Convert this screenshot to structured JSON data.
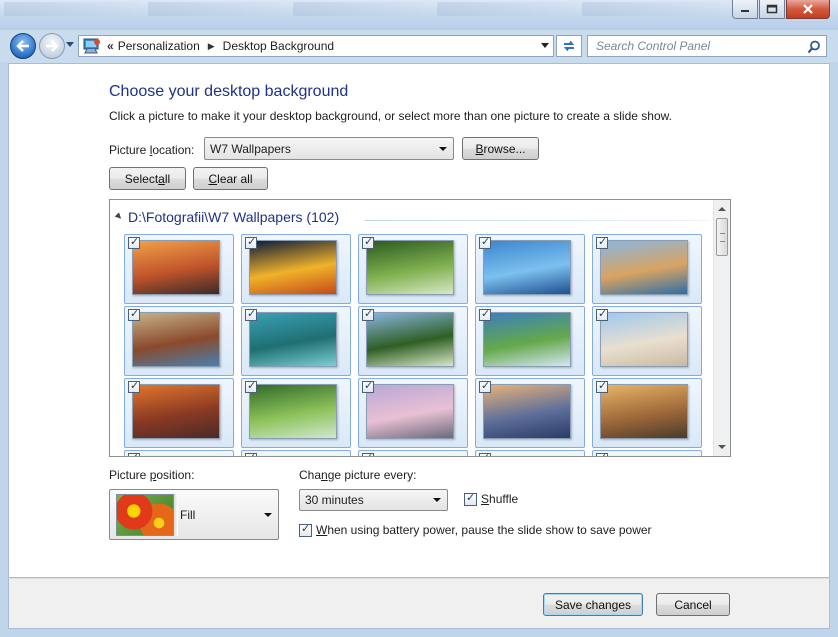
{
  "address": {
    "breadcrumbs": [
      "Personalization",
      "Desktop Background"
    ],
    "chevron": "«",
    "search_placeholder": "Search Control Panel"
  },
  "page": {
    "heading": "Choose your desktop background",
    "subtext": "Click a picture to make it your desktop background, or select more than one picture to create a slide show."
  },
  "picture_location": {
    "label_prefix": "Picture ",
    "label_accel": "l",
    "label_suffix": "ocation:",
    "value": "W7 Wallpapers",
    "browse_prefix": "",
    "browse_accel": "B",
    "browse_suffix": "rowse..."
  },
  "selection_buttons": {
    "select_all_prefix": "Select ",
    "select_all_accel": "a",
    "select_all_suffix": "ll",
    "clear_all_prefix": "",
    "clear_all_accel": "C",
    "clear_all_suffix": "lear all"
  },
  "gallery": {
    "group_title": "D:\\Fotografii\\W7 Wallpapers (102)",
    "thumbnails": [
      {
        "name": "baobab-trees",
        "checked": true,
        "colors": [
          "#f2a04a",
          "#c0542a",
          "#3a2a2a"
        ]
      },
      {
        "name": "sydney-fireworks",
        "checked": true,
        "colors": [
          "#0d1a3a",
          "#f0b22a",
          "#c24b1b"
        ]
      },
      {
        "name": "forest-waterfall",
        "checked": true,
        "colors": [
          "#2c5a22",
          "#7fb04e",
          "#d9e8c8"
        ]
      },
      {
        "name": "sydney-harbour",
        "checked": true,
        "colors": [
          "#3b86d0",
          "#7cc0ee",
          "#1f4f8f"
        ]
      },
      {
        "name": "twelve-apostles",
        "checked": true,
        "colors": [
          "#89b6e0",
          "#d9a362",
          "#2d6fa6"
        ]
      },
      {
        "name": "river-gorge",
        "checked": true,
        "colors": [
          "#c6b28a",
          "#8a4a2c",
          "#4b7fb0"
        ]
      },
      {
        "name": "tropical-islands",
        "checked": true,
        "colors": [
          "#3aa0b5",
          "#1f6f72",
          "#7dcfd6"
        ]
      },
      {
        "name": "lily-pads",
        "checked": true,
        "colors": [
          "#8ab4e0",
          "#2f5f24",
          "#d8e6c8"
        ]
      },
      {
        "name": "rainbow-coast",
        "checked": true,
        "colors": [
          "#3a7fbf",
          "#65a84a",
          "#d4e6f5"
        ]
      },
      {
        "name": "sand-dunes",
        "checked": true,
        "colors": [
          "#9ec8ee",
          "#e9dfcf",
          "#c9b9a4"
        ]
      },
      {
        "name": "canyon-sunset",
        "checked": true,
        "colors": [
          "#e2762e",
          "#8a3a22",
          "#4a2a2a"
        ]
      },
      {
        "name": "rainforest-stream",
        "checked": true,
        "colors": [
          "#2f6a2a",
          "#8ec25a",
          "#cfe8d0"
        ]
      },
      {
        "name": "stonehenge",
        "checked": true,
        "colors": [
          "#b7a8d6",
          "#e9c0d4",
          "#6a6a7a"
        ]
      },
      {
        "name": "tower-bridge",
        "checked": true,
        "colors": [
          "#e8b27a",
          "#5f6f9a",
          "#2a3a6a"
        ]
      },
      {
        "name": "misty-lake",
        "checked": true,
        "colors": [
          "#e8b468",
          "#a06a3a",
          "#4a3a2a"
        ]
      },
      {
        "name": "partial-1",
        "checked": true,
        "colors": [
          "#c07040",
          "#7a4030",
          "#3a2a2a"
        ]
      },
      {
        "name": "partial-2",
        "checked": true,
        "colors": [
          "#4a8ac0",
          "#2f6aa0",
          "#1f3f6a"
        ]
      },
      {
        "name": "partial-3",
        "checked": true,
        "colors": [
          "#8ab4d8",
          "#5f8fba",
          "#3f6a90"
        ]
      },
      {
        "name": "partial-4",
        "checked": true,
        "colors": [
          "#6a9fd8",
          "#3f7ab5",
          "#2a4f80"
        ]
      },
      {
        "name": "partial-5",
        "checked": true,
        "colors": [
          "#7fb0e0",
          "#4f86c0",
          "#2f5a8a"
        ]
      }
    ]
  },
  "picture_position": {
    "label_prefix": "Picture ",
    "label_accel": "p",
    "label_suffix": "osition:",
    "value": "Fill"
  },
  "slideshow": {
    "change_prefix": "Cha",
    "change_accel": "n",
    "change_suffix": "ge picture every:",
    "interval": "30 minutes",
    "shuffle_accel": "S",
    "shuffle_suffix": "huffle",
    "shuffle_checked": true,
    "battery_accel": "W",
    "battery_suffix": "hen using battery power, pause the slide show to save power",
    "battery_checked": true
  },
  "footer": {
    "save_label": "Save changes",
    "cancel_label": "Cancel"
  },
  "colors": {
    "heading": "#1e3287",
    "frame": "#c1d5ea",
    "close_button": "#c23e22"
  }
}
